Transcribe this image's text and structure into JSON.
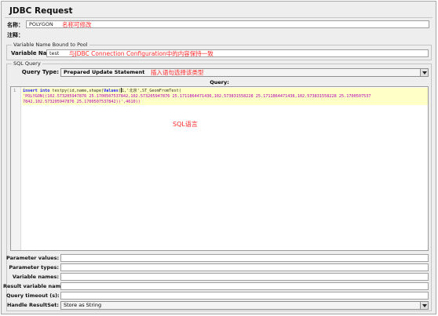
{
  "title": "JDBC Request",
  "name": {
    "label": "名称：",
    "value": "POLYGON",
    "note": "名称可修改"
  },
  "comment": {
    "label": "注释：",
    "value": ""
  },
  "pool": {
    "group_title": "Variable Name Bound to Pool",
    "label": "Variable Name:",
    "value": "test",
    "note": "与JDBC Connection Configuration中的内容保持一致"
  },
  "sql": {
    "group_title": "SQL Query",
    "query_type_label": "Query Type:",
    "query_type_value": "Prepared Update Statement",
    "query_type_note": "插入语句选择该类型",
    "query_header": "Query:",
    "line_number": "1",
    "code_kw1": "insert into",
    "code_mid": " testpy(id,name,shape)",
    "code_kw2": "Values",
    "code_pre_cursor": "(",
    "code_post_cursor": "1,'北京',ST_GeomFromText(",
    "code_line2": "'POLYGON((102.573205947876 25.1700507537842,102.573205947876 25.1711864471436,102.573831558228 25.1711864471436,102.573831558228 25.1700507537",
    "code_line3": "7842,102.573205947876 25.1700507537842))',4610))",
    "editor_note": "SQL语言"
  },
  "params": [
    {
      "label": "Parameter values:",
      "value": ""
    },
    {
      "label": "Parameter types:",
      "value": ""
    },
    {
      "label": "Variable names:",
      "value": ""
    },
    {
      "label": "Result variable name:",
      "value": ""
    },
    {
      "label": "Query timeout (s):",
      "value": ""
    }
  ],
  "resultset": {
    "label": "Handle ResultSet:",
    "value": "Store as String"
  },
  "colors": {
    "annotation": "#ff2a2a",
    "keyword": "#1a1aff",
    "string": "#b400b4",
    "highlight": "#ffffc8"
  }
}
